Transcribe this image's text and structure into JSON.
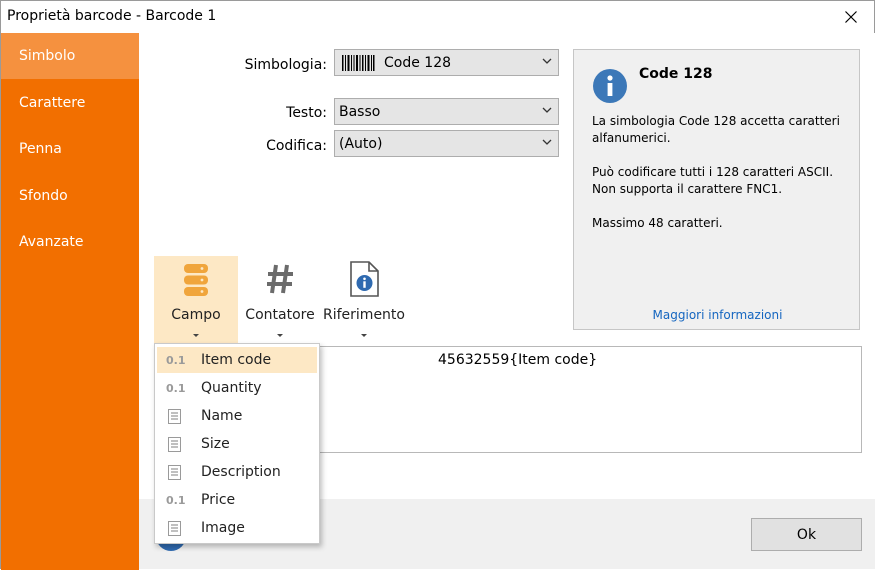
{
  "window": {
    "title": "Proprietà barcode - Barcode 1"
  },
  "sidebar": {
    "items": [
      {
        "label": "Simbolo",
        "active": true
      },
      {
        "label": "Carattere",
        "active": false
      },
      {
        "label": "Penna",
        "active": false
      },
      {
        "label": "Sfondo",
        "active": false
      },
      {
        "label": "Avanzate",
        "active": false
      }
    ]
  },
  "form": {
    "symbology_label": "Simbologia:",
    "symbology_value": "Code 128",
    "text_label": "Testo:",
    "text_value": "Basso",
    "encoding_label": "Codifica:",
    "encoding_value": "(Auto)"
  },
  "info": {
    "title": "Code 128",
    "line1": "La simbologia Code 128 accetta caratteri alfanumerici.",
    "line2": "Può codificare tutti i 128 caratteri ASCII. Non supporta il carattere FNC1.",
    "line3": "Massimo 48 caratteri.",
    "link": "Maggiori informazioni"
  },
  "toolbar": {
    "field_label": "Campo",
    "counter_label": "Contatore",
    "reference_label": "Riferimento"
  },
  "data_field": {
    "value": "45632559{Item code}"
  },
  "field_menu": {
    "items": [
      {
        "label": "Item code",
        "type": "number",
        "badge": "0.1",
        "highlighted": true
      },
      {
        "label": "Quantity",
        "type": "number",
        "badge": "0.1",
        "highlighted": false
      },
      {
        "label": "Name",
        "type": "text",
        "badge": "",
        "highlighted": false
      },
      {
        "label": "Size",
        "type": "text",
        "badge": "",
        "highlighted": false
      },
      {
        "label": "Description",
        "type": "text",
        "badge": "",
        "highlighted": false
      },
      {
        "label": "Price",
        "type": "number",
        "badge": "0.1",
        "highlighted": false
      },
      {
        "label": "Image",
        "type": "text",
        "badge": "",
        "highlighted": false
      }
    ]
  },
  "footer": {
    "ok_label": "Ok"
  },
  "colors": {
    "sidebar": "#f26f00",
    "sidebar_active": "#f5913f",
    "highlight": "#fde8c5",
    "info_icon": "#3c78b8",
    "link": "#1566c0"
  }
}
